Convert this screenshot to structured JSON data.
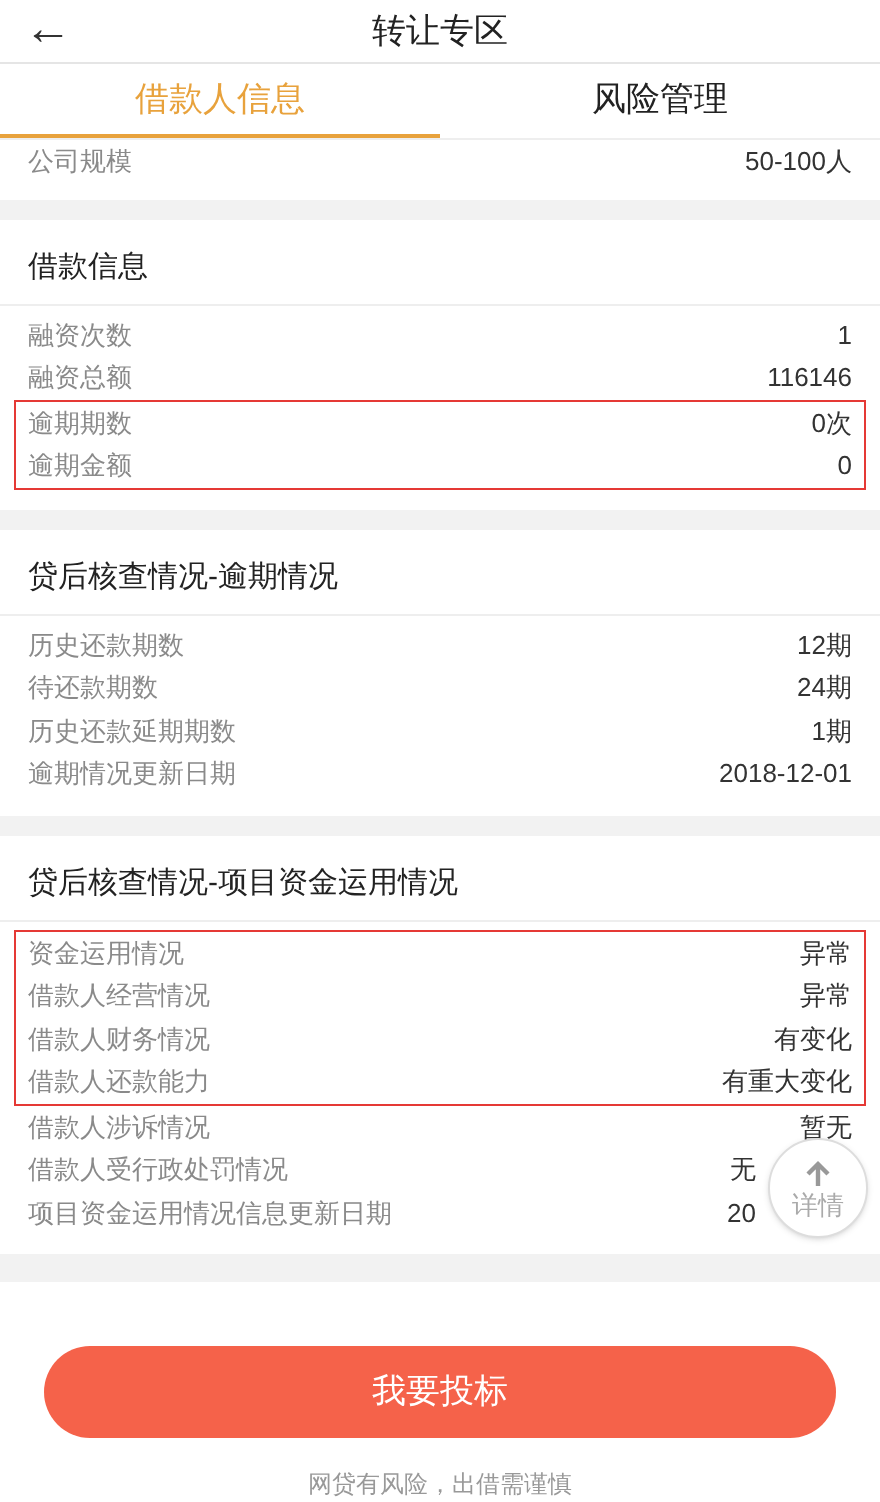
{
  "header": {
    "back_icon": "←",
    "title": "转让专区"
  },
  "tabs": [
    {
      "label": "借款人信息",
      "selected": true
    },
    {
      "label": "风险管理",
      "selected": false
    }
  ],
  "sections": [
    {
      "rows": [
        {
          "label": "公司规模",
          "value": "50-100人",
          "highlighted": false
        }
      ]
    },
    {
      "title": "借款信息",
      "rows": [
        {
          "label": "融资次数",
          "value": "1",
          "highlighted": false
        },
        {
          "label": "融资总额",
          "value": "116146",
          "highlighted": false
        },
        {
          "label": "逾期期数",
          "value": "0次",
          "highlighted": true
        },
        {
          "label": "逾期金额",
          "value": "0",
          "highlighted": true
        }
      ]
    },
    {
      "title": "贷后核查情况-逾期情况",
      "rows": [
        {
          "label": "历史还款期数",
          "value": "12期",
          "highlighted": false
        },
        {
          "label": "待还款期数",
          "value": "24期",
          "highlighted": false
        },
        {
          "label": "历史还款延期期数",
          "value": "1期",
          "highlighted": false
        },
        {
          "label": "逾期情况更新日期",
          "value": "2018-12-01",
          "highlighted": false
        }
      ]
    },
    {
      "title": "贷后核查情况-项目资金运用情况",
      "rows": [
        {
          "label": "资金运用情况",
          "value": "异常",
          "highlighted": true
        },
        {
          "label": "借款人经营情况",
          "value": "异常",
          "highlighted": true
        },
        {
          "label": "借款人财务情况",
          "value": "有变化",
          "highlighted": true
        },
        {
          "label": "借款人还款能力",
          "value": "有重大变化",
          "highlighted": true
        },
        {
          "label": "借款人涉诉情况",
          "value": "暂无",
          "highlighted": false
        },
        {
          "label": "借款人受行政处罚情况",
          "value": "无",
          "highlighted": false,
          "obscured": true
        },
        {
          "label": "项目资金运用情况信息更新日期",
          "value": "20",
          "highlighted": false,
          "obscured": true
        }
      ]
    }
  ],
  "float_button": {
    "label": "详情"
  },
  "submit_button": "我要投标",
  "footnote": "网贷有风险，出借需谨慎"
}
